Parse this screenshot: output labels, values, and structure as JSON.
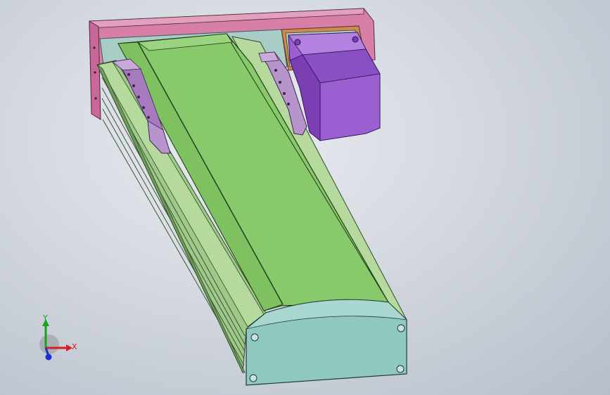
{
  "triad": {
    "x_label": "X",
    "y_label": "Y",
    "x_color": "#d42020",
    "y_color": "#18a418",
    "z_color": "#1a2fd8"
  },
  "colors": {
    "background_center": "#e9ecf1",
    "background_edge": "#b7bec9",
    "mount_plate": "#d77fa6",
    "rail_top": "#88c96c",
    "rail_side": "#a9d28a",
    "end_cap": "#8fc8be",
    "motor": "#9b5fd2",
    "clamp_blocks": "#b894cc",
    "gasket": "#c98a54",
    "housing": "#a9cdc6"
  },
  "scene": {
    "parts": [
      "mount-plate",
      "motor",
      "linear-rail-body",
      "carriage-cover",
      "end-cap",
      "clamp-block-left",
      "clamp-block-right"
    ]
  }
}
